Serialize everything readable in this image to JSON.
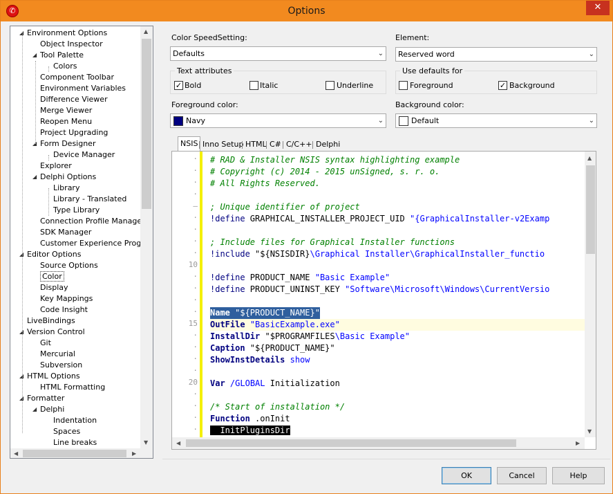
{
  "window": {
    "title": "Options"
  },
  "tree": {
    "items": [
      {
        "label": "Environment Options",
        "level": 0,
        "expanded": true
      },
      {
        "label": "Object Inspector",
        "level": 1
      },
      {
        "label": "Tool Palette",
        "level": 1,
        "expanded": true
      },
      {
        "label": "Colors",
        "level": 2
      },
      {
        "label": "Component Toolbar",
        "level": 1
      },
      {
        "label": "Environment Variables",
        "level": 1
      },
      {
        "label": "Difference Viewer",
        "level": 1
      },
      {
        "label": "Merge Viewer",
        "level": 1
      },
      {
        "label": "Reopen Menu",
        "level": 1
      },
      {
        "label": "Project Upgrading",
        "level": 1
      },
      {
        "label": "Form Designer",
        "level": 1,
        "expanded": true
      },
      {
        "label": "Device Manager",
        "level": 2
      },
      {
        "label": "Explorer",
        "level": 1
      },
      {
        "label": "Delphi Options",
        "level": 1,
        "expanded": true
      },
      {
        "label": "Library",
        "level": 2
      },
      {
        "label": "Library - Translated",
        "level": 2
      },
      {
        "label": "Type Library",
        "level": 2
      },
      {
        "label": "Connection Profile Manager",
        "level": 1
      },
      {
        "label": "SDK Manager",
        "level": 1
      },
      {
        "label": "Customer Experience Program",
        "level": 1
      },
      {
        "label": "Editor Options",
        "level": 0,
        "expanded": true
      },
      {
        "label": "Source Options",
        "level": 1
      },
      {
        "label": "Color",
        "level": 1,
        "selected": true
      },
      {
        "label": "Display",
        "level": 1
      },
      {
        "label": "Key Mappings",
        "level": 1
      },
      {
        "label": "Code Insight",
        "level": 1
      },
      {
        "label": "LiveBindings",
        "level": 0
      },
      {
        "label": "Version Control",
        "level": 0,
        "expanded": true
      },
      {
        "label": "Git",
        "level": 1
      },
      {
        "label": "Mercurial",
        "level": 1
      },
      {
        "label": "Subversion",
        "level": 1
      },
      {
        "label": "HTML Options",
        "level": 0,
        "expanded": true
      },
      {
        "label": "HTML Formatting",
        "level": 1
      },
      {
        "label": "Formatter",
        "level": 0,
        "expanded": true
      },
      {
        "label": "Delphi",
        "level": 1,
        "expanded": true
      },
      {
        "label": "Indentation",
        "level": 2
      },
      {
        "label": "Spaces",
        "level": 2
      },
      {
        "label": "Line breaks",
        "level": 2
      }
    ]
  },
  "color_speed": {
    "label": "Color SpeedSetting:",
    "value": "Defaults"
  },
  "element": {
    "label": "Element:",
    "value": "Reserved word"
  },
  "text_attributes": {
    "title": "Text attributes",
    "bold": {
      "label": "Bold",
      "checked": true
    },
    "italic": {
      "label": "Italic",
      "checked": false
    },
    "underline": {
      "label": "Underline",
      "checked": false
    }
  },
  "use_defaults": {
    "title": "Use defaults for",
    "foreground": {
      "label": "Foreground",
      "checked": false
    },
    "background": {
      "label": "Background",
      "checked": true
    }
  },
  "foreground_color": {
    "label": "Foreground color:",
    "value": "Navy",
    "swatch": "#000080"
  },
  "background_color": {
    "label": "Background color:",
    "value": "Default",
    "swatch": "#ffffff"
  },
  "tabs": [
    "NSIS",
    "Inno Setup",
    "HTML",
    "C#",
    "C/C++",
    "Delphi"
  ],
  "gutter_numbers": [
    "10",
    "15",
    "20"
  ],
  "code_lines": [
    "# RAD & Installer NSIS syntax highlighting example",
    "# Copyright (c) 2014 - 2015 unSigned, s. r. o.",
    "# All Rights Reserved.",
    "",
    "; Unique identifier of project",
    [
      "!define",
      " GRAPHICAL_INSTALLER_PROJECT_UID ",
      "\"{GraphicalInstaller-v2Examp"
    ],
    "",
    "; Include files for Graphical Installer functions",
    [
      "!include",
      " \"${NSISDIR}",
      "\\Graphical Installer\\GraphicalInstaller_functio"
    ],
    "",
    [
      "!define",
      " PRODUCT_NAME ",
      "\"Basic Example\""
    ],
    [
      "!define",
      " PRODUCT_UNINST_KEY ",
      "\"Software\\Microsoft\\Windows\\CurrentVersio"
    ],
    "",
    [
      "Name",
      " \"${PRODUCT_NAME}\""
    ],
    [
      "OutFile",
      " ",
      "\"BasicExample.exe\""
    ],
    [
      "InstallDir",
      " \"$PROGRAMFILES",
      "\\Basic Example\""
    ],
    [
      "Caption",
      " \"${PRODUCT_NAME}\""
    ],
    [
      "ShowInstDetails",
      " ",
      "show"
    ],
    "",
    [
      "Var",
      " ",
      "/GLOBAL",
      " Initialization"
    ],
    "",
    "/* Start of installation */",
    [
      "Function",
      " .onInit"
    ],
    "  InitPluginsDir"
  ],
  "buttons": {
    "ok": "OK",
    "cancel": "Cancel",
    "help": "Help"
  },
  "colors": {
    "titlebar": "#f28a1f",
    "selection": "#2f5f9e",
    "comment": "#008000",
    "keyword": "#000080",
    "string": "#0000ff"
  }
}
